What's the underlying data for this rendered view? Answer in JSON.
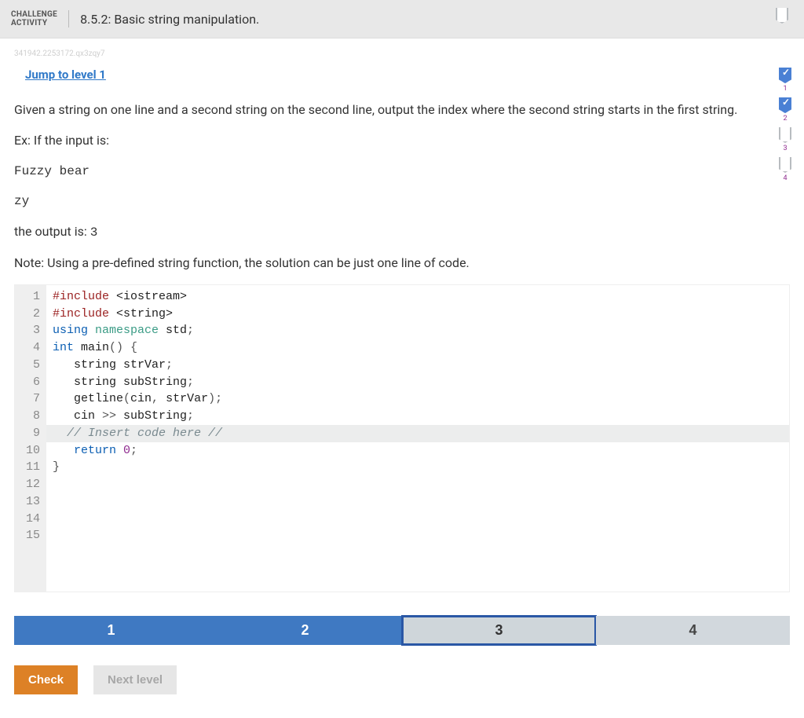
{
  "header": {
    "label_line1": "CHALLENGE",
    "label_line2": "ACTIVITY",
    "title": "8.5.2: Basic string manipulation."
  },
  "meta_id": "341942.2253172.qx3zqy7",
  "jump_link": "Jump to level 1",
  "side_progress": [
    {
      "label": "1",
      "checked": true
    },
    {
      "label": "2",
      "checked": true
    },
    {
      "label": "3",
      "checked": false
    },
    {
      "label": "4",
      "checked": false
    }
  ],
  "problem": {
    "p1": "Given a string on one line and a second string on the second line, output the index where the second string starts in the first string.",
    "p2": "Ex: If the input is:",
    "sample1": "Fuzzy bear",
    "sample2": "zy",
    "p3_prefix": "the output is: ",
    "p3_value": "3",
    "p4": "Note: Using a pre-defined string function, the solution can be just one line of code."
  },
  "code_lines": [
    {
      "n": "1"
    },
    {
      "n": "2"
    },
    {
      "n": "3"
    },
    {
      "n": "4"
    },
    {
      "n": "5"
    },
    {
      "n": "6"
    },
    {
      "n": "7"
    },
    {
      "n": "8"
    },
    {
      "n": "9"
    },
    {
      "n": "10"
    },
    {
      "n": "11"
    },
    {
      "n": "12"
    },
    {
      "n": "13"
    },
    {
      "n": "14"
    },
    {
      "n": "15"
    }
  ],
  "code": {
    "l1_a": "#include ",
    "l1_b": "<iostream>",
    "l2_a": "#include ",
    "l2_b": "<string>",
    "l3_a": "using",
    "l3_b": " namespace",
    "l3_c": " std",
    "l3_d": ";",
    "l4": "",
    "l5_a": "int",
    "l5_b": " main",
    "l5_c": "() {",
    "l6_a": "   string ",
    "l6_b": "strVar",
    "l6_c": ";",
    "l7_a": "   string ",
    "l7_b": "subString",
    "l7_c": ";",
    "l8": "",
    "l9_a": "   getline",
    "l9_b": "(",
    "l9_c": "cin",
    "l9_d": ", ",
    "l9_e": "strVar",
    "l9_f": ");",
    "l10_a": "   cin ",
    "l10_b": ">>",
    "l10_c": " subString",
    "l10_d": ";",
    "l11": "",
    "l12": "  // Insert code here //",
    "l13": "",
    "l14_a": "   return ",
    "l14_b": "0",
    "l14_c": ";",
    "l15": "}"
  },
  "levels": {
    "l1": "1",
    "l2": "2",
    "l3": "3",
    "l4": "4"
  },
  "buttons": {
    "check": "Check",
    "next": "Next level"
  }
}
